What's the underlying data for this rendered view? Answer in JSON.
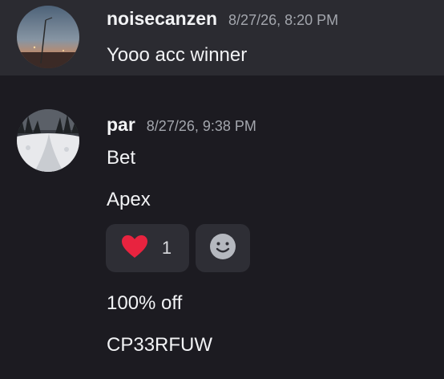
{
  "messages": [
    {
      "username": "noisecanzen",
      "timestamp": "8/27/26, 8:20 PM",
      "lines": [
        "Yooo acc winner"
      ],
      "avatar": "sunset-lamppost-avatar"
    },
    {
      "username": "par",
      "timestamp": "8/27/26, 9:38 PM",
      "lines": [
        "Bet",
        "Apex",
        "100% off",
        "CP33RFUW"
      ],
      "avatar": "snowy-forest-avatar",
      "reactions": [
        {
          "icon": "heart-icon",
          "count": "1",
          "color": "#e8233f"
        }
      ],
      "add_reaction_icon": "smiley-add-reaction-icon"
    }
  ]
}
